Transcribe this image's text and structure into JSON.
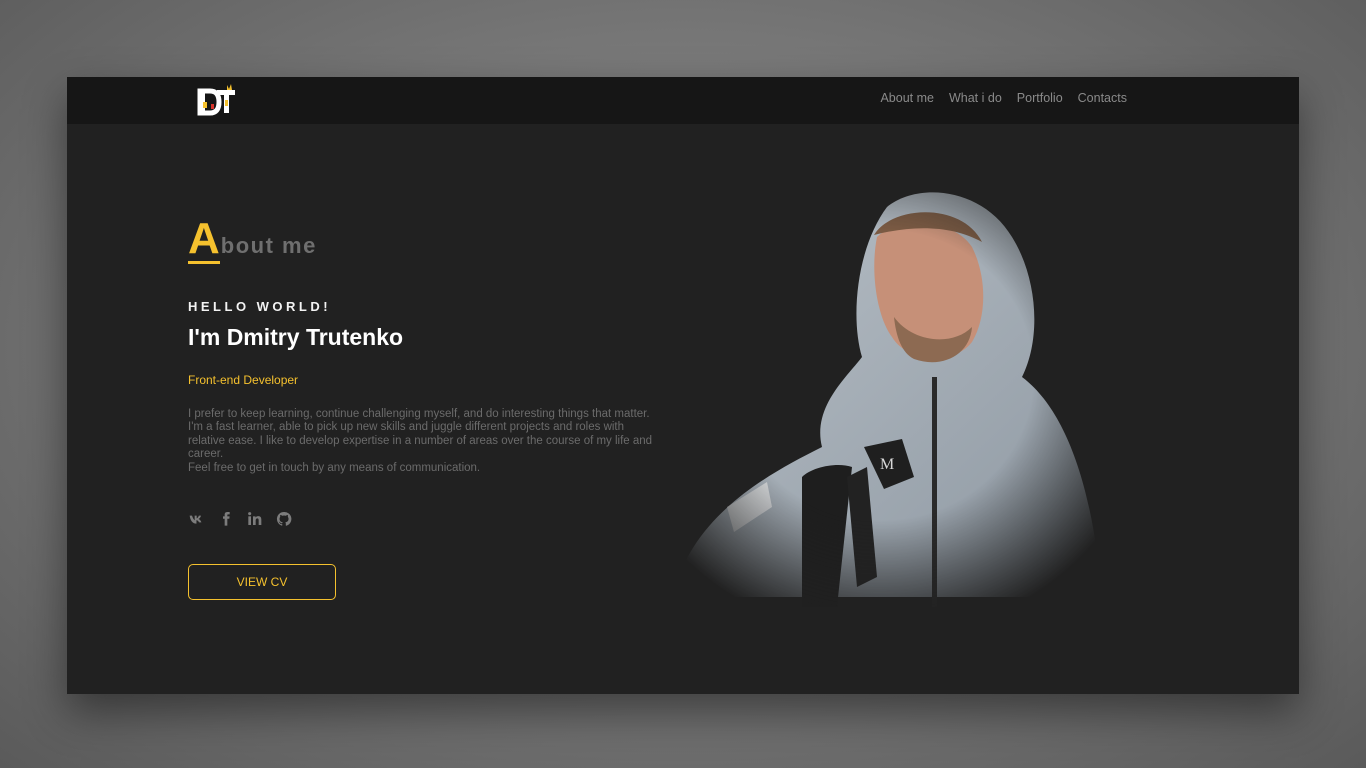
{
  "colors": {
    "accent": "#f5c12e",
    "panel": "#212121",
    "navbar": "#161616",
    "muted_text": "#6b6b6b"
  },
  "header": {
    "logo_text": "DT",
    "nav": [
      {
        "label": "About me"
      },
      {
        "label": "What i do"
      },
      {
        "label": "Portfolio"
      },
      {
        "label": "Contacts"
      }
    ]
  },
  "about": {
    "title_first_letter": "A",
    "title_rest": "bout me",
    "eyebrow": "HELLO WORLD!",
    "name": "I'm Dmitry Trutenko",
    "role": "Front-end Developer",
    "bio": [
      "I prefer to keep learning, continue challenging myself, and do interesting things that matter.",
      "I'm a fast learner, able to pick up new skills and juggle different projects and roles with relative ease. I like to develop expertise in a number of areas over the course of my life and career.",
      "Feel free to get in touch by any means of communication."
    ],
    "socials": [
      {
        "icon": "vk-icon"
      },
      {
        "icon": "facebook-icon"
      },
      {
        "icon": "linkedin-icon"
      },
      {
        "icon": "github-icon"
      }
    ],
    "cv_button_label": "VIEW CV"
  }
}
